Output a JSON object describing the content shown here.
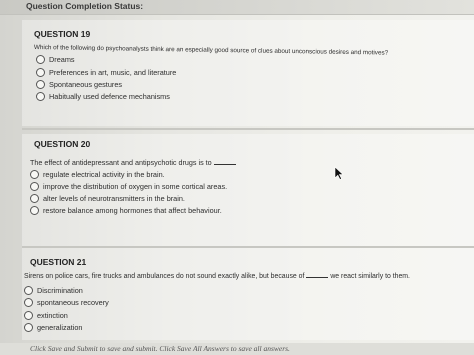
{
  "status": {
    "label": "Question Completion Status:"
  },
  "questions": [
    {
      "title": "QUESTION 19",
      "text": "Which of the following do psychoanalysts think are an especially good source of clues about unconscious desires and motives?",
      "options": [
        "Dreams",
        "Preferences in art, music, and literature",
        "Spontaneous gestures",
        "Habitually used defence mechanisms"
      ]
    },
    {
      "title": "QUESTION 20",
      "text": "The effect of antidepressant and antipsychotic drugs is to",
      "options": [
        "regulate electrical activity in the brain.",
        "improve the distribution of oxygen in some cortical areas.",
        "alter levels of neurotransmitters in the brain.",
        "restore balance among hormones that affect behaviour."
      ]
    },
    {
      "title": "QUESTION 21",
      "text_before": "Sirens on police cars, fire trucks and ambulances do not sound exactly alike, but because of",
      "text_after": "we react similarly to them.",
      "options": [
        "Discrimination",
        "spontaneous recovery",
        "extinction",
        "generalization"
      ]
    }
  ],
  "footer": {
    "text": "Click Save and Submit to save and submit. Click Save All Answers to save all answers."
  },
  "colors": {
    "page": "#efefea",
    "divider": "#c7c7c2",
    "text": "#2e2e2e"
  },
  "icons": {
    "cursor": "mouse-pointer-icon",
    "radio": "radio-button-icon"
  }
}
